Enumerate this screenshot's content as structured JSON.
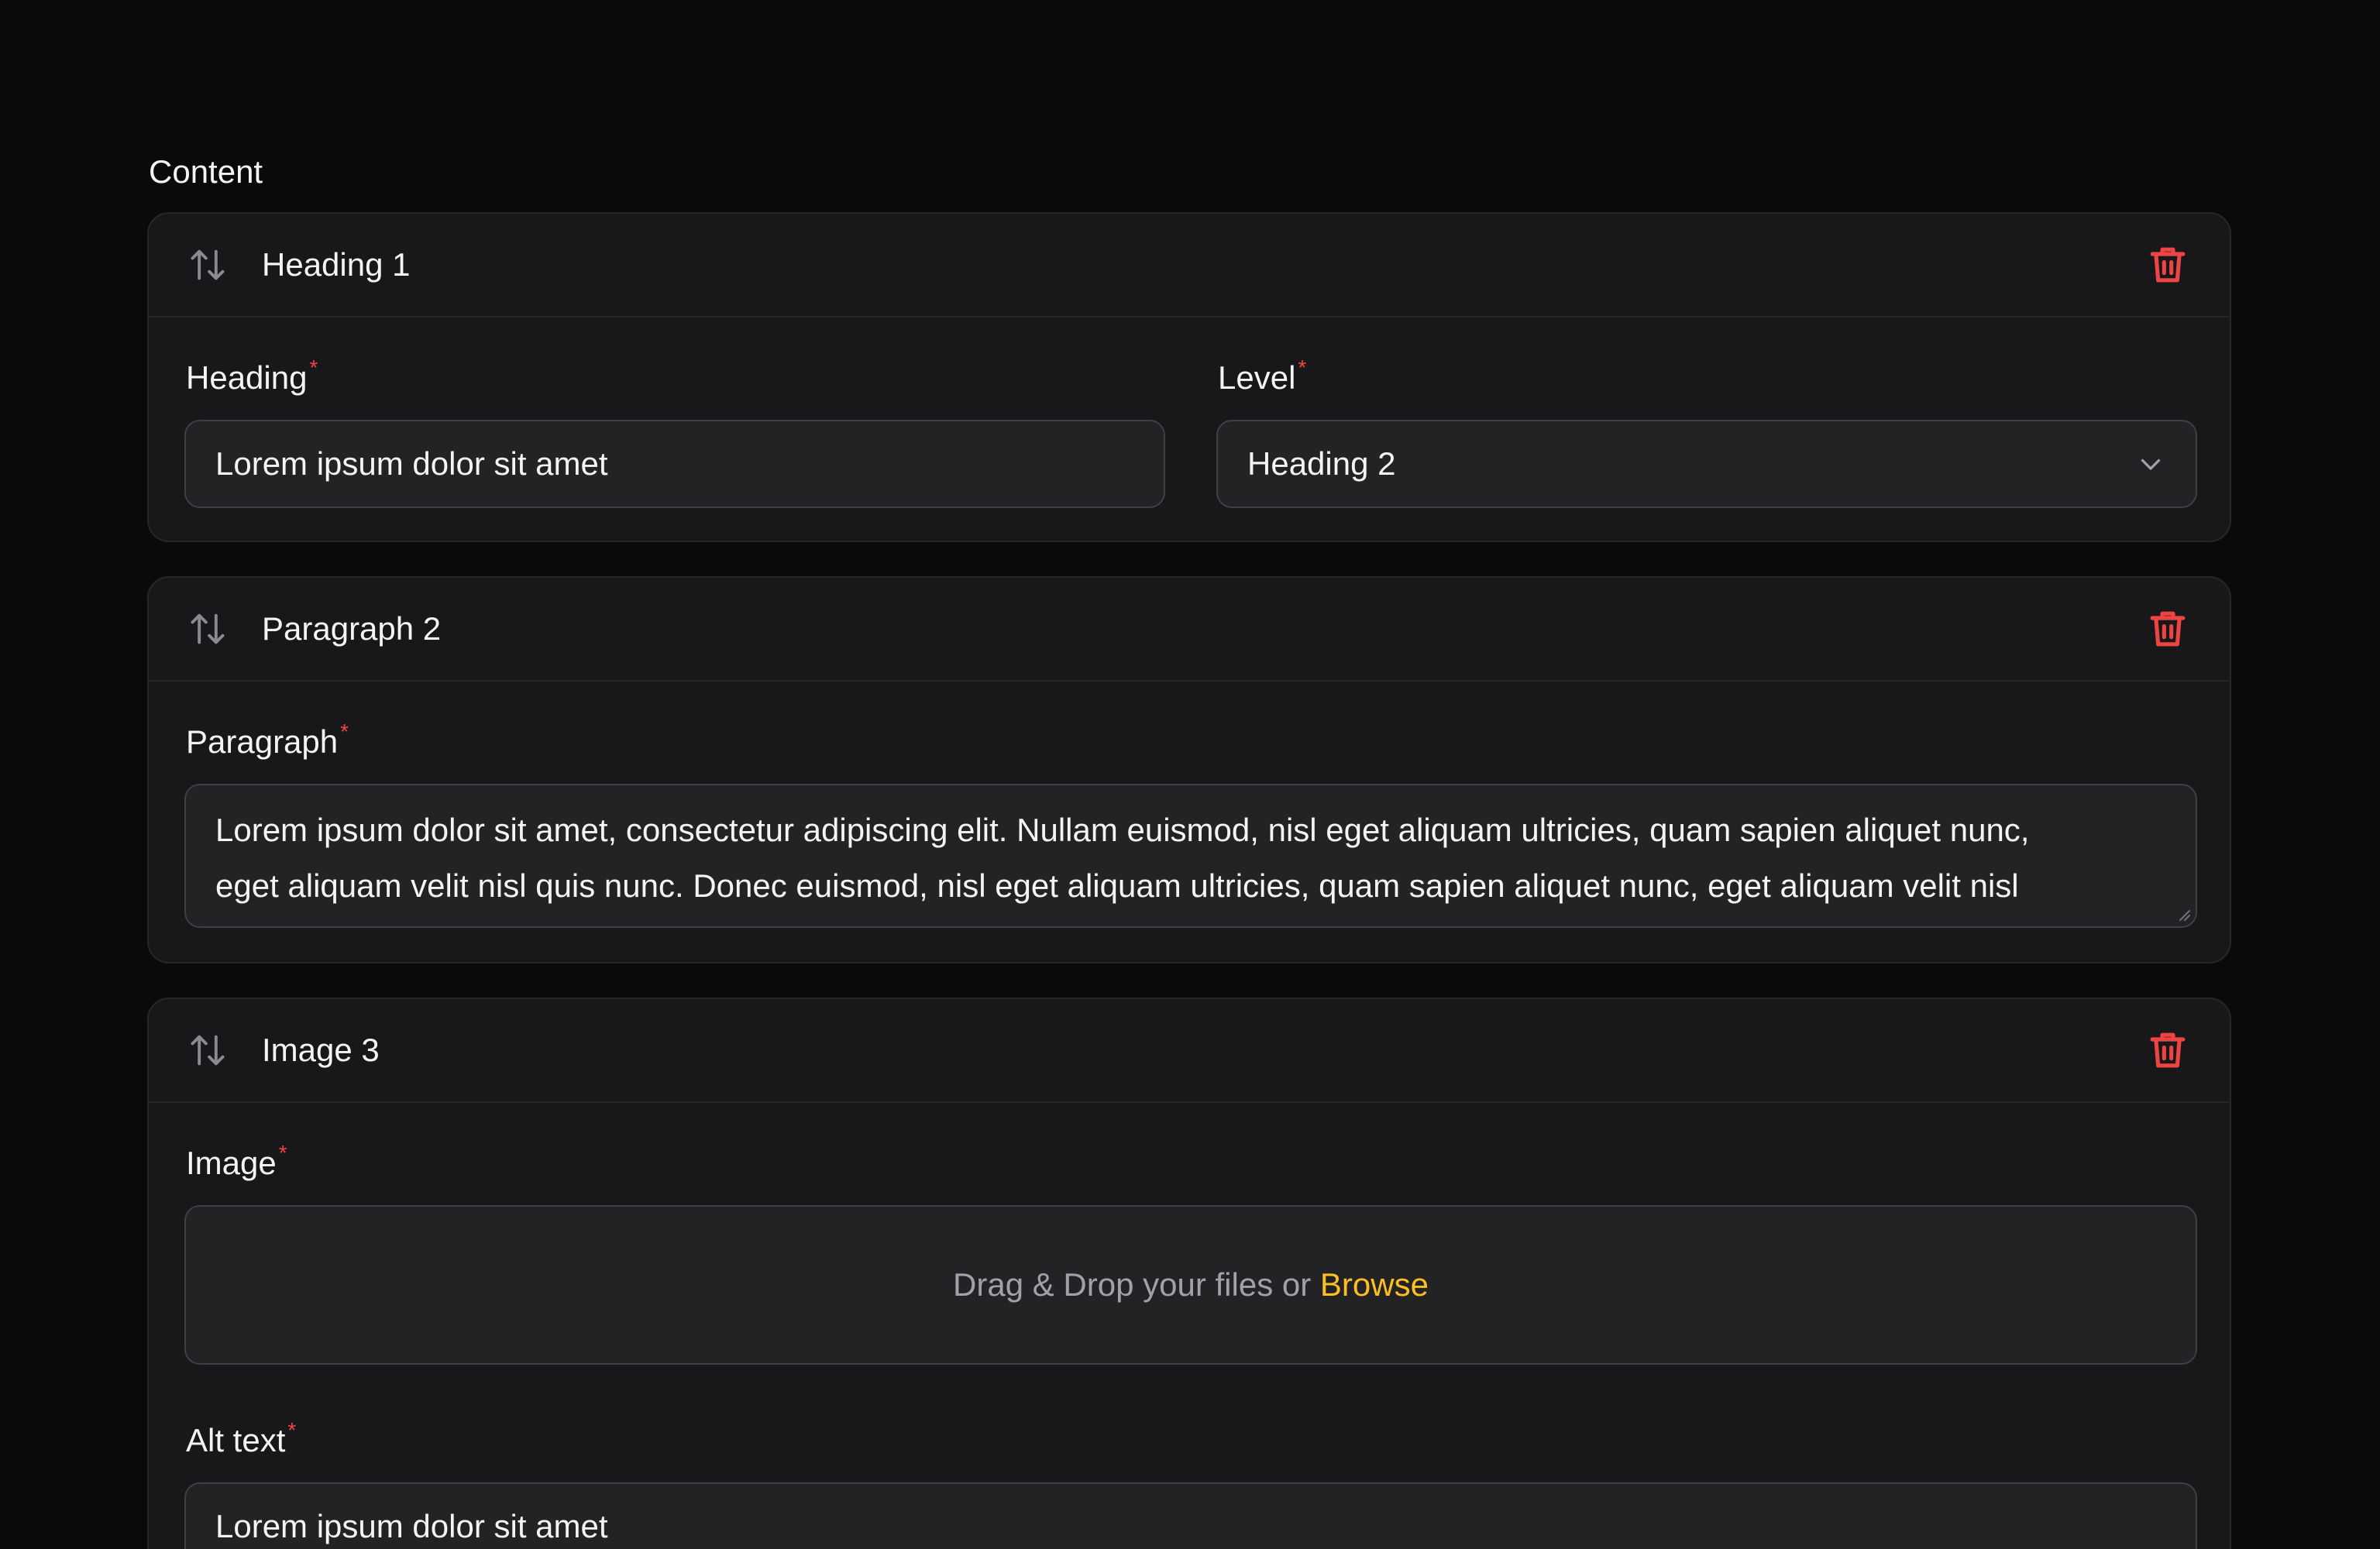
{
  "section_title": "Content",
  "colors": {
    "background": "#0a0a0c",
    "panel": "#18181b",
    "input": "#232326",
    "border": "#3f3f46",
    "danger": "#ef4444",
    "accent": "#fbbf24"
  },
  "blocks": [
    {
      "title": "Heading 1",
      "icons": {
        "sort": "sort-arrows-icon",
        "delete": "trash-icon"
      },
      "fields": {
        "heading": {
          "label": "Heading",
          "required_mark": "*",
          "value": "Lorem ipsum dolor sit amet"
        },
        "level": {
          "label": "Level",
          "required_mark": "*",
          "value": "Heading 2"
        }
      }
    },
    {
      "title": "Paragraph 2",
      "icons": {
        "sort": "sort-arrows-icon",
        "delete": "trash-icon"
      },
      "fields": {
        "paragraph": {
          "label": "Paragraph",
          "required_mark": "*",
          "line1": "Lorem ipsum dolor sit amet, consectetur adipiscing elit. Nullam euismod, nisl eget aliquam ultricies, quam sapien aliquet nunc,",
          "line2": "eget aliquam velit nisl quis nunc. Donec euismod, nisl eget aliquam ultricies, quam sapien aliquet nunc, eget aliquam velit nisl"
        }
      }
    },
    {
      "title": "Image 3",
      "icons": {
        "sort": "sort-arrows-icon",
        "delete": "trash-icon"
      },
      "fields": {
        "image": {
          "label": "Image",
          "required_mark": "*",
          "dropzone_text": "Drag & Drop your files or",
          "browse_label": "Browse"
        },
        "alt_text": {
          "label": "Alt text",
          "required_mark": "*",
          "value": "Lorem ipsum dolor sit amet"
        }
      }
    }
  ]
}
